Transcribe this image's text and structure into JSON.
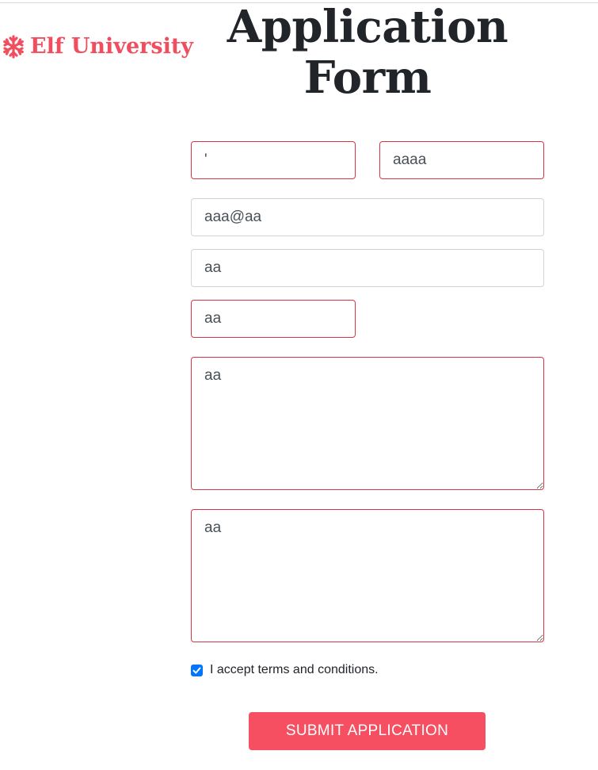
{
  "brand": {
    "name": "Elf University",
    "icon": "snowflake-icon",
    "color": "#f04e5e"
  },
  "page": {
    "title": "Application Form"
  },
  "form": {
    "first_name": "'",
    "last_name": "aaaa",
    "email": "aaa@aa",
    "phone": "aa",
    "small_field": "aa",
    "textarea_one": "aa",
    "textarea_two": "aa",
    "terms_label": "I accept terms and conditions.",
    "terms_checked": true,
    "submit_label": "SUBMIT APPLICATION"
  },
  "colors": {
    "invalid_border": "#dc3545",
    "submit_background": "#f74f62",
    "checkbox": "#0075ff"
  }
}
